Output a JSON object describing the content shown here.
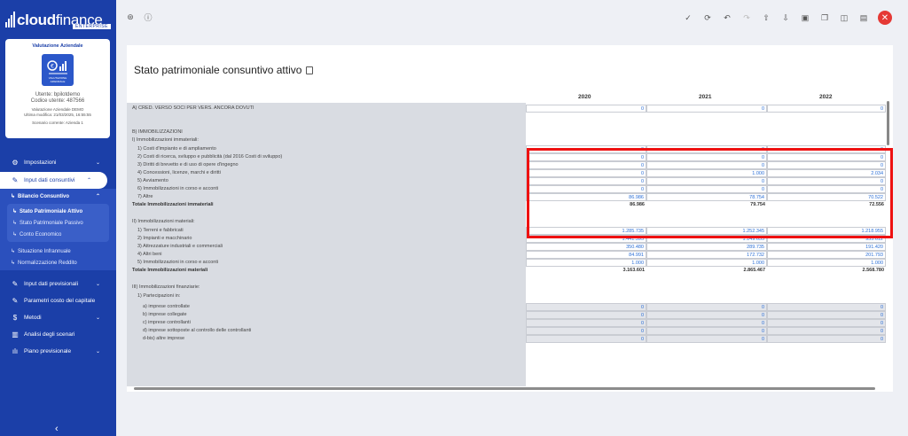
{
  "brand": {
    "name_bold": "cloud",
    "name_thin": "finance",
    "edition": "ENTERPRISE"
  },
  "card": {
    "title": "Valutazione Aziendale",
    "icon_caption": "VALUTAZIONE AZIENDALE",
    "user": "Utente: bpilotdemo",
    "code": "Codice utente: 487566",
    "demo": "Valutazione Aziendale DEMO",
    "last_edit": "Ultima modifica: 21/03/2025, 16:55:55",
    "scenario": "Scenario corrente: Azienda 1"
  },
  "nav": {
    "impostazioni": "Impostazioni",
    "input_consuntivi": "Input dati consuntivi",
    "bilancio": "Bilancio Consuntivo",
    "sp_attivo": "Stato Patrimoniale Attivo",
    "sp_passivo": "Stato Patrimoniale Passivo",
    "conto_economico": "Conto Economico",
    "infrannuale": "Situazione Infrannuale",
    "normalizzazione": "Normalizzazione Reddito",
    "input_previsionali": "Input dati previsionali",
    "parametri": "Parametri costo del capitale",
    "metodi": "Metodi",
    "analisi": "Analisi degli scenari",
    "piano": "Piano previsionale"
  },
  "page": {
    "title": "Stato patrimoniale consuntivo attivo"
  },
  "years": [
    "2020",
    "2021",
    "2022"
  ],
  "rows": {
    "r1": {
      "label": "A) CRED. VERSO SOCI PER VERS. ANCORA DOVUTI",
      "v": [
        "0",
        "0",
        "0"
      ]
    },
    "r2": {
      "label": "B) IMMOBILIZZAZIONI"
    },
    "r3": {
      "label": "I) Immobilizzazioni immateriali:"
    },
    "r4": {
      "label": "1) Costi d'impianto e di ampliamento",
      "v": [
        "0",
        "0",
        "0"
      ]
    },
    "r5": {
      "label": "2) Costi di ricerca, sviluppo e pubblicità (dal 2016 Costi di sviluppo)",
      "v": [
        "0",
        "0",
        "0"
      ]
    },
    "r6": {
      "label": "3) Diritti di brevetto e di uso di opere d'ingegno",
      "v": [
        "0",
        "0",
        "0"
      ]
    },
    "r7": {
      "label": "4) Concessioni, licenze, marchi e diritti",
      "v": [
        "0",
        "1.000",
        "2.034"
      ]
    },
    "r8": {
      "label": "5) Avviamento",
      "v": [
        "0",
        "0",
        "0"
      ]
    },
    "r9": {
      "label": "6) Immobilizzazioni in corso e acconti",
      "v": [
        "0",
        "0",
        "0"
      ]
    },
    "r10": {
      "label": "7) Altre",
      "v": [
        "86.986",
        "78.754",
        "70.522"
      ]
    },
    "r11": {
      "label": "Totale Immobilizzazioni immateriali",
      "v": [
        "86.986",
        "79.754",
        "72.556"
      ]
    },
    "r12": {
      "label": "II) Immobilizzazioni materiali:"
    },
    "r13": {
      "label": "1) Terreni e fabbricati",
      "v": [
        "1.285.735",
        "1.252.345",
        "1.218.955"
      ]
    },
    "r14": {
      "label": "2) Impianti e macchinario",
      "v": [
        "1.441.395",
        "1.149.655",
        "955.612"
      ]
    },
    "r15": {
      "label": "3) Attrezzature industriali e commerciali",
      "v": [
        "350.480",
        "289.735",
        "191.420"
      ]
    },
    "r16": {
      "label": "4) Altri beni",
      "v": [
        "84.991",
        "172.732",
        "201.793"
      ]
    },
    "r17": {
      "label": "5) Immobilizzazioni in corso e acconti",
      "v": [
        "1.000",
        "1.000",
        "1.000"
      ]
    },
    "r18": {
      "label": "Totale Immobilizzazioni materiali",
      "v": [
        "3.163.601",
        "2.865.467",
        "2.568.780"
      ]
    },
    "r19": {
      "label": "III) Immobilizzazioni finanziarie:"
    },
    "r20": {
      "label": "1) Partecipazioni in:"
    },
    "r21": {
      "label": "a) imprese controllate",
      "v": [
        "0",
        "0",
        "0"
      ]
    },
    "r22": {
      "label": "b) imprese collegate",
      "v": [
        "0",
        "0",
        "0"
      ]
    },
    "r23": {
      "label": "c) imprese controllanti",
      "v": [
        "0",
        "0",
        "0"
      ]
    },
    "r24": {
      "label": "d) imprese sottoposte al controllo delle controllanti",
      "v": [
        "0",
        "0",
        "0"
      ]
    },
    "r25": {
      "label": "d-bis) altre imprese",
      "v": [
        "0",
        "0",
        "0"
      ]
    }
  }
}
